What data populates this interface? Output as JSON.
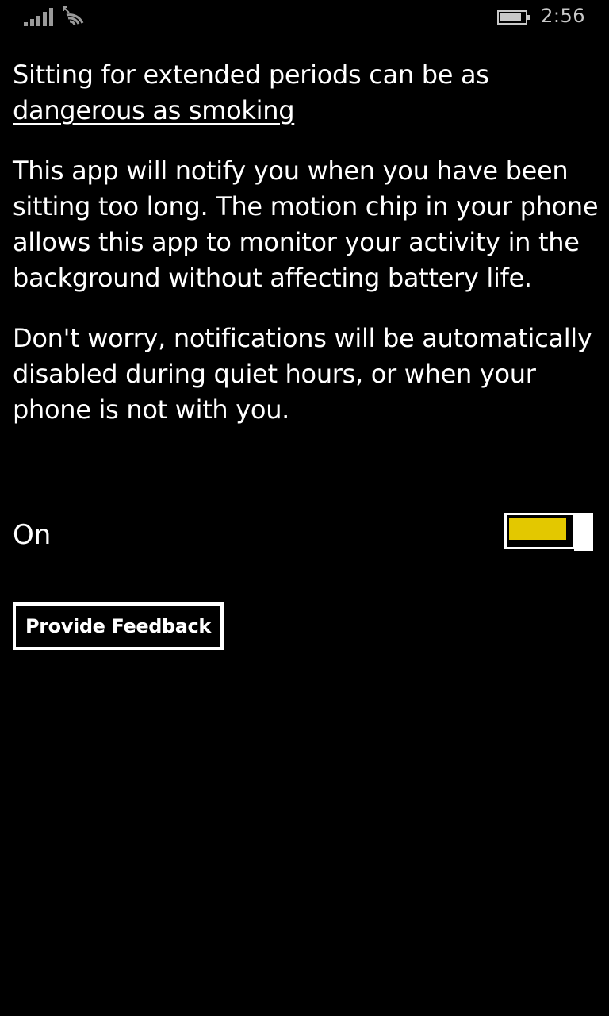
{
  "status_bar": {
    "time": "2:56",
    "signal_icon": "signal-bars-icon",
    "wifi_icon": "wifi-icon",
    "battery_icon": "battery-icon",
    "text_color": "#c8c8c8"
  },
  "content": {
    "intro_text": "Sitting for extended periods can be as ",
    "intro_link": "dangerous as smoking",
    "paragraph_2": "This app will notify you when you have been sitting too long. The motion chip in your phone allows this app to monitor your activity in the background without affecting battery life.",
    "paragraph_3": "Don't worry, notifications will be automatically disabled during quiet hours, or when your phone is not with you."
  },
  "toggle": {
    "label": "On",
    "state": true,
    "accent_color": "#e3c800"
  },
  "feedback_button": {
    "label": "Provide Feedback"
  },
  "colors": {
    "background": "#000000",
    "foreground": "#ffffff"
  }
}
